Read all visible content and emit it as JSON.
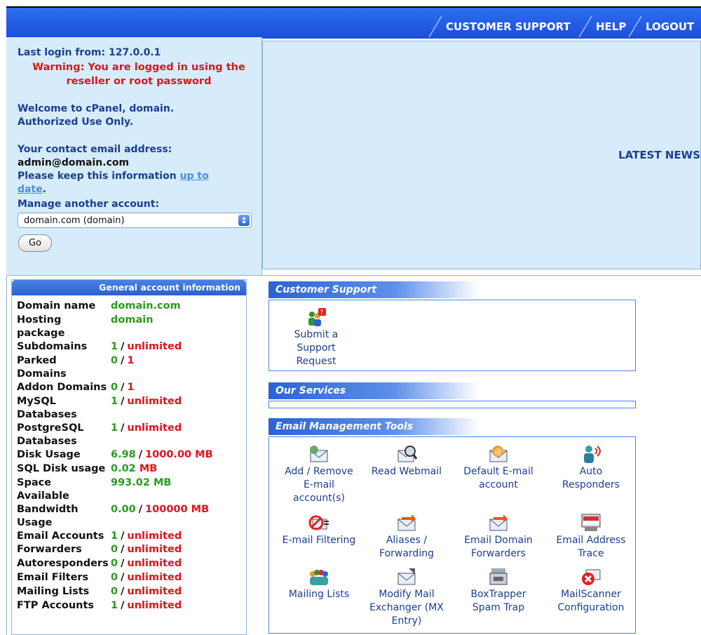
{
  "nav": {
    "support": "CUSTOMER SUPPORT",
    "help": "HELP",
    "logout": "LOGOUT"
  },
  "info": {
    "last_login": "Last login from: 127.0.0.1",
    "warning_line1": "Warning: You are logged in using the",
    "warning_line2": "reseller or root password",
    "welcome_line1": "Welcome to cPanel, domain.",
    "welcome_line2": "Authorized Use Only.",
    "contact_label": "Your contact email address:",
    "contact_email": "admin@domain.com",
    "keep_text": "Please keep this information ",
    "keep_link1": "up to",
    "keep_link2": "date",
    "keep_period": ".",
    "manage_label": "Manage another account:",
    "select_value": "domain.com (domain)",
    "go_label": "Go"
  },
  "news": {
    "title": "LATEST NEWS"
  },
  "account": {
    "header": "General account information",
    "rows": [
      {
        "label1": "Domain name",
        "label2": "",
        "v1": "domain.com",
        "v2": ""
      },
      {
        "label1": "Hosting",
        "label2": "package",
        "v1": "domain",
        "v2": ""
      },
      {
        "label1": "Subdomains",
        "label2": "",
        "v1": "1",
        "v2": "unlimited"
      },
      {
        "label1": "Parked",
        "label2": "Domains",
        "v1": "0",
        "v2": "1"
      },
      {
        "label1": "Addon Domains",
        "label2": "",
        "v1": "0",
        "v2": "1"
      },
      {
        "label1": "MySQL",
        "label2": "Databases",
        "v1": "1",
        "v2": "unlimited"
      },
      {
        "label1": "PostgreSQL",
        "label2": "Databases",
        "v1": "1",
        "v2": "unlimited"
      },
      {
        "label1": "Disk Usage",
        "label2": "",
        "v1": "6.98",
        "v2": "1000.00 MB"
      },
      {
        "label1": "SQL Disk usage",
        "label2": "",
        "v1": "0.02",
        "v2": "MB"
      },
      {
        "label1": "Space",
        "label2": "Available",
        "v1": "993.02 MB",
        "v2": ""
      },
      {
        "label1": "Bandwidth",
        "label2": "Usage",
        "v1": "0.00",
        "v2": "100000 MB"
      },
      {
        "label1": "Email Accounts",
        "label2": "",
        "v1": "1",
        "v2": "unlimited"
      },
      {
        "label1": "Forwarders",
        "label2": "",
        "v1": "0",
        "v2": "unlimited"
      },
      {
        "label1": "Autoresponders",
        "label2": "",
        "v1": "0",
        "v2": "unlimited"
      },
      {
        "label1": "Email Filters",
        "label2": "",
        "v1": "0",
        "v2": "unlimited"
      },
      {
        "label1": "Mailing Lists",
        "label2": "",
        "v1": "0",
        "v2": "unlimited"
      },
      {
        "label1": "FTP Accounts",
        "label2": "",
        "v1": "1",
        "v2": "unlimited"
      }
    ],
    "slash": "/"
  },
  "sections": {
    "support_title": "Customer Support",
    "support_items": [
      {
        "l1": "Submit a",
        "l2": "Support",
        "l3": "Request",
        "icon": "support-request-icon"
      }
    ],
    "services_title": "Our Services",
    "email_title": "Email Management Tools",
    "email_items": [
      {
        "l1": "Add / Remove",
        "l2": "E-mail",
        "l3": "account(s)",
        "icon": "envelope-add-icon"
      },
      {
        "l1": "Read Webmail",
        "l2": "",
        "l3": "",
        "icon": "webmail-magnifier-icon"
      },
      {
        "l1": "Default E-mail",
        "l2": "account",
        "l3": "",
        "icon": "at-envelope-icon"
      },
      {
        "l1": "Auto",
        "l2": "Responders",
        "l3": "",
        "icon": "auto-responder-icon"
      },
      {
        "l1": "E-mail Filtering",
        "l2": "",
        "l3": "",
        "icon": "mail-filter-icon"
      },
      {
        "l1": "Aliases /",
        "l2": "Forwarding",
        "l3": "",
        "icon": "envelope-forward-icon"
      },
      {
        "l1": "Email Domain",
        "l2": "Forwarders",
        "l3": "",
        "icon": "envelope-domain-forward-icon"
      },
      {
        "l1": "Email Address",
        "l2": "Trace",
        "l3": "",
        "icon": "address-trace-icon"
      },
      {
        "l1": "Mailing Lists",
        "l2": "",
        "l3": "",
        "icon": "mailing-lists-icon"
      },
      {
        "l1": "Modify Mail",
        "l2": "Exchanger (MX",
        "l3": "Entry)",
        "icon": "mx-envelope-icon"
      },
      {
        "l1": "BoxTrapper",
        "l2": "Spam Trap",
        "l3": "",
        "icon": "boxtrapper-icon"
      },
      {
        "l1": "MailScanner",
        "l2": "Configuration",
        "l3": "",
        "icon": "mailscanner-icon"
      }
    ]
  }
}
